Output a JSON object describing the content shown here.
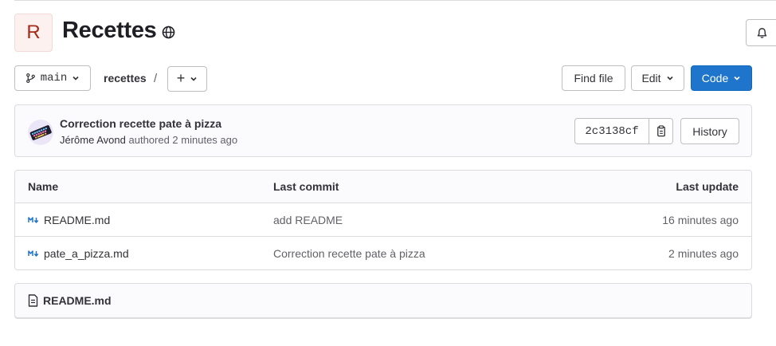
{
  "project": {
    "avatar_letter": "R",
    "title": "Recettes"
  },
  "toolbar": {
    "branch": "main",
    "repo_crumb": "recettes",
    "separator": "/",
    "add_label": "+",
    "find_file": "Find file",
    "edit": "Edit",
    "code": "Code"
  },
  "last_commit": {
    "title": "Correction recette pate à pizza",
    "author": "Jérôme Avond",
    "meta_suffix": "authored 2 minutes ago",
    "sha": "2c3138cf",
    "history": "History"
  },
  "file_table": {
    "headers": {
      "name": "Name",
      "last_commit": "Last commit",
      "last_update": "Last update"
    },
    "rows": [
      {
        "name": "README.md",
        "last_commit": "add README",
        "last_update": "16 minutes ago"
      },
      {
        "name": "pate_a_pizza.md",
        "last_commit": "Correction recette pate à pizza",
        "last_update": "2 minutes ago"
      }
    ]
  },
  "readme": {
    "filename": "README.md"
  },
  "colors": {
    "primary": "#1f75cb",
    "avatar_bg": "#fcf1ef",
    "avatar_text": "#a32c18",
    "markdown_icon": "#1f75cb"
  }
}
